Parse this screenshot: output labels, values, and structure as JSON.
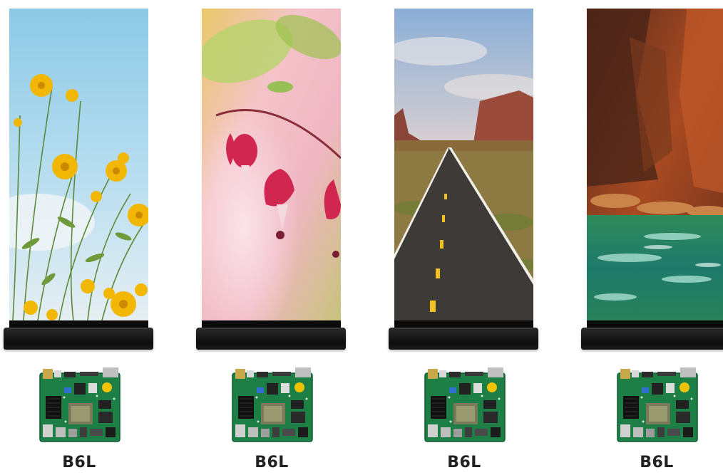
{
  "products": [
    {
      "model": "B6L",
      "scene": "yellow-flowers"
    },
    {
      "model": "B6L",
      "scene": "pink-bleeding-heart-flowers"
    },
    {
      "model": "B6L",
      "scene": "desert-road"
    },
    {
      "model": "B6L",
      "scene": "red-canyon-river"
    }
  ],
  "colors": {
    "background": "#ffffff",
    "stand": "#111111",
    "pcb": "#1f8a4c",
    "label": "#222222"
  }
}
